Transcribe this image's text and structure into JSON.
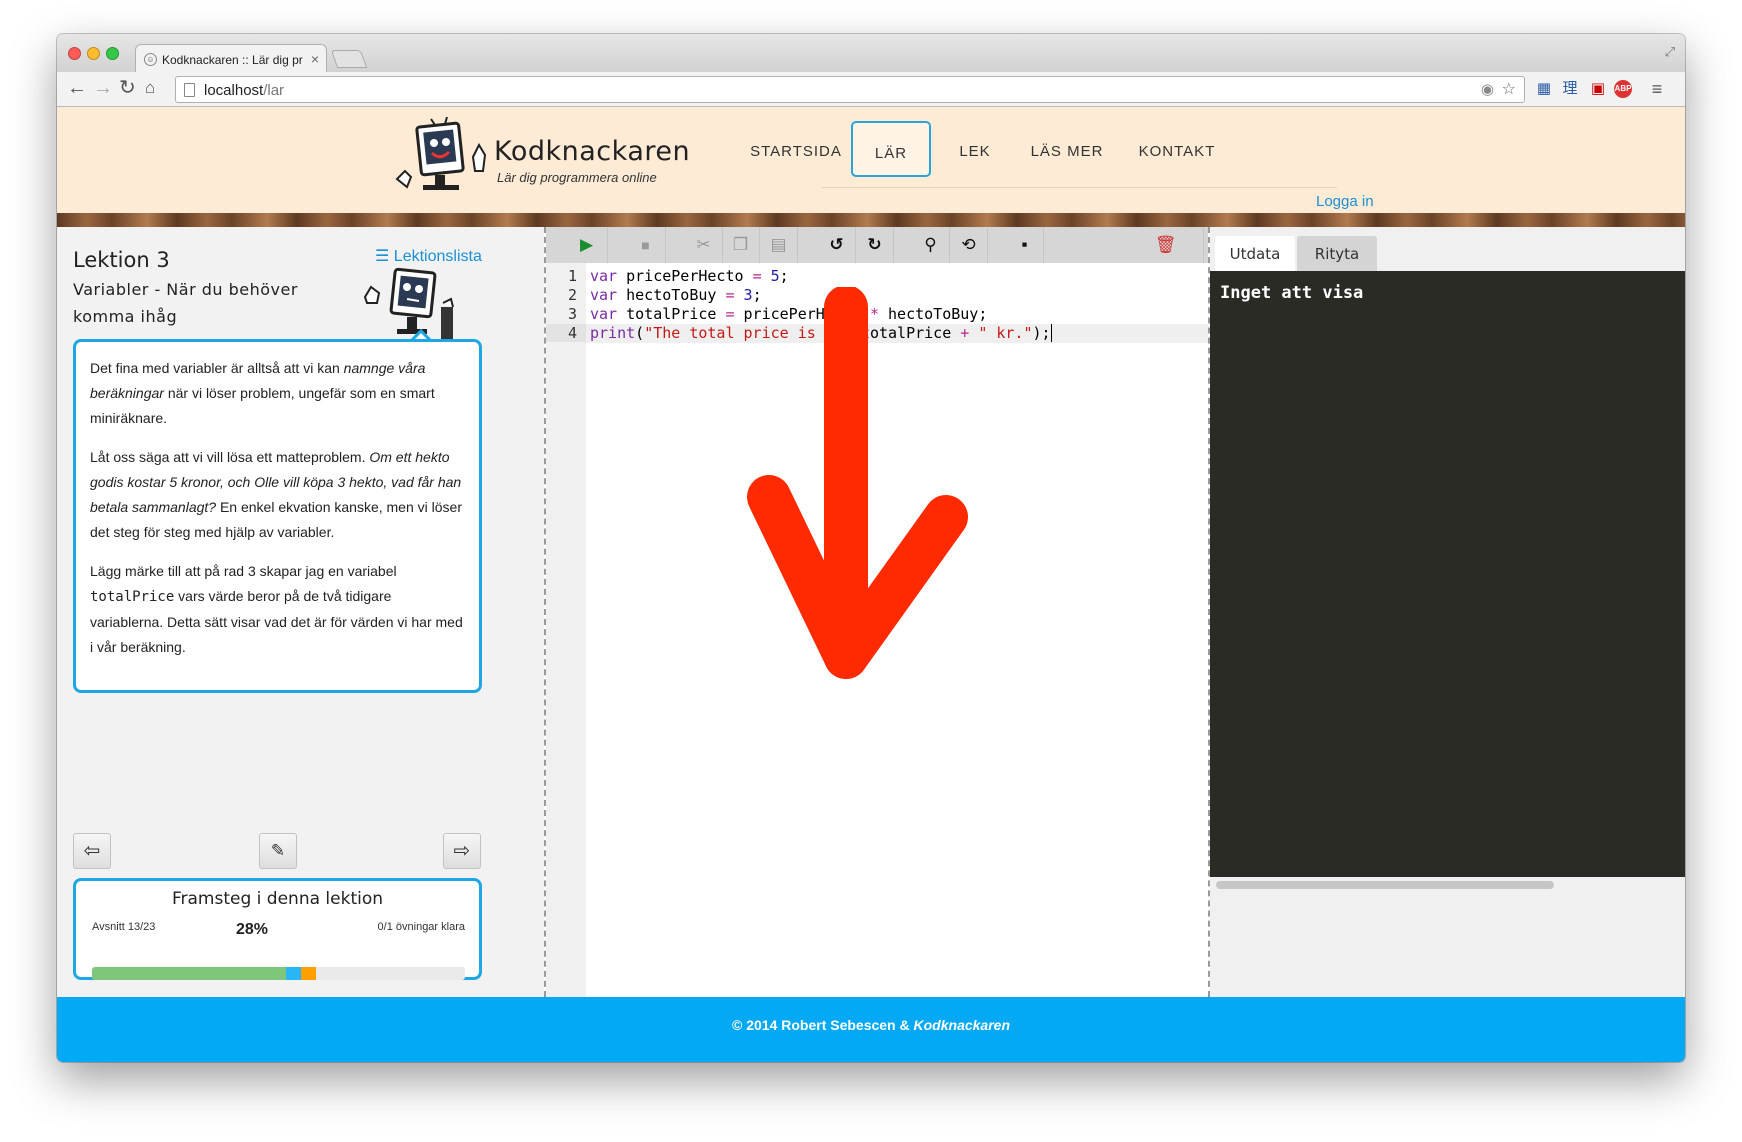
{
  "browser": {
    "tab_title": "Kodknackaren :: Lär dig pr",
    "url_host": "localhost",
    "url_path": "/lar"
  },
  "site": {
    "logo_title": "Kodknackaren",
    "logo_subtitle": "Lär dig programmera online",
    "nav": [
      "STARTSIDA",
      "LÄR",
      "LEK",
      "LÄS MER",
      "KONTAKT"
    ],
    "active_nav": "LÄR",
    "login": "Logga in"
  },
  "lesson": {
    "title": "Lektion 3",
    "subtitle": "Variabler - När du behöver komma ihåg",
    "list_link": "Lektionslista",
    "p1_a": "Det fina med variabler är alltså att vi kan ",
    "p1_em": "namnge våra beräkningar",
    "p1_b": " när vi löser problem, ungefär som en smart miniräknare.",
    "p2_a": "Låt oss säga att vi vill lösa ett matteproblem. ",
    "p2_em": "Om ett hekto godis kostar 5 kronor, och Olle vill köpa 3 hekto, vad får han betala sammanlagt?",
    "p2_b": " En enkel ekvation kanske, men vi löser det steg för steg med hjälp av variabler.",
    "p3_a": "Lägg märke till att på rad 3 skapar jag en variabel ",
    "p3_code": "totalPrice",
    "p3_b": " vars värde beror på de två tidigare variablerna. Detta sätt visar vad det är för värden vi har med i vår beräkning."
  },
  "progress": {
    "title": "Framsteg i denna lektion",
    "section": "Avsnitt 13/23",
    "percent_label": "28%",
    "exercises": "0/1 övningar klara",
    "done_fraction": 0.52,
    "current_fraction": 0.04,
    "exercise_fraction": 0.04,
    "colors": {
      "done": "#7dc67a",
      "current": "#29b6f6",
      "exercise": "#ffa000"
    }
  },
  "editor": {
    "line_numbers": [
      "1",
      "2",
      "3",
      "4"
    ]
  },
  "output": {
    "tabs": [
      "Utdata",
      "Rityta"
    ],
    "empty_text": "Inget att visa"
  },
  "footer": {
    "text": "© 2014 Robert Sebescen & ",
    "brand": "Kodknackaren"
  },
  "icons": [
    "play-icon",
    "stop-icon",
    "cut-icon",
    "copy-icon",
    "paste-icon",
    "undo-icon",
    "redo-icon",
    "search-icon",
    "replace-icon",
    "save-icon",
    "trash-icon",
    "arrow-left-icon",
    "edit-icon",
    "arrow-right-icon",
    "menu-icon"
  ]
}
